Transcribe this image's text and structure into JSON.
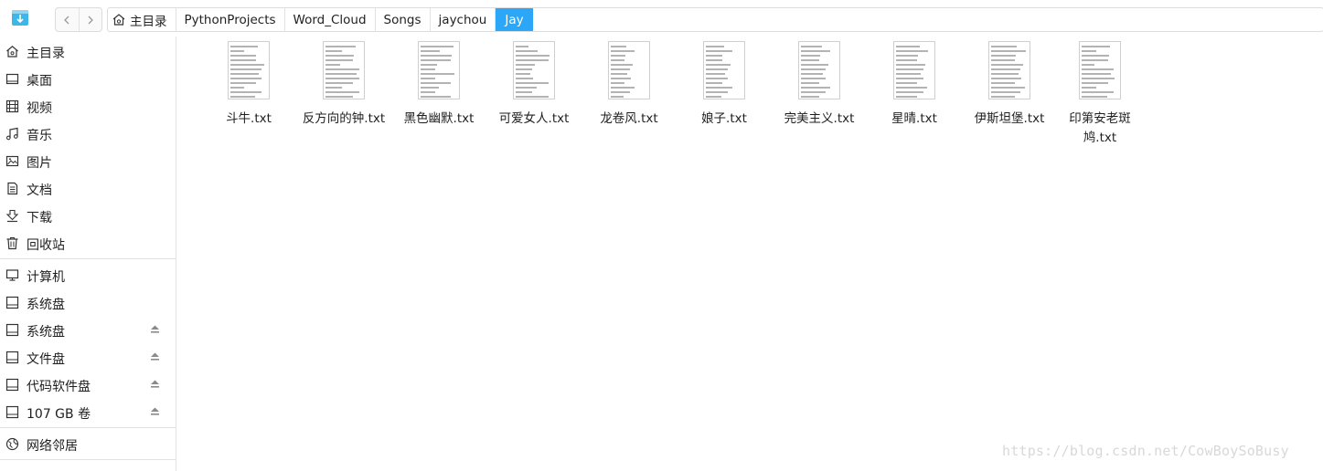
{
  "breadcrumb": {
    "home": "主目录",
    "items": [
      "PythonProjects",
      "Word_Cloud",
      "Songs",
      "jaychou"
    ],
    "current": "Jay"
  },
  "sidebar": {
    "items": [
      {
        "label": "主目录",
        "icon": "home-icon"
      },
      {
        "label": "桌面",
        "icon": "desktop-icon"
      },
      {
        "label": "视频",
        "icon": "video-icon"
      },
      {
        "label": "音乐",
        "icon": "music-icon"
      },
      {
        "label": "图片",
        "icon": "picture-icon"
      },
      {
        "label": "文档",
        "icon": "document-icon"
      },
      {
        "label": "下载",
        "icon": "download-icon"
      },
      {
        "label": "回收站",
        "icon": "trash-icon"
      }
    ],
    "devices": [
      {
        "label": "计算机",
        "icon": "computer-icon"
      },
      {
        "label": "系统盘",
        "icon": "disk-icon",
        "eject": false
      },
      {
        "label": "系统盘",
        "icon": "disk-icon",
        "eject": true
      },
      {
        "label": "文件盘",
        "icon": "disk-icon",
        "eject": true
      },
      {
        "label": "代码软件盘",
        "icon": "disk-icon",
        "eject": true
      },
      {
        "label": "107 GB 卷",
        "icon": "disk-icon",
        "eject": true
      }
    ],
    "network": {
      "label": "网络邻居",
      "icon": "network-icon"
    }
  },
  "files": [
    "斗牛.txt",
    "反方向的钟.txt",
    "黑色幽默.txt",
    "可爱女人.txt",
    "龙卷风.txt",
    "娘子.txt",
    "完美主义.txt",
    "星晴.txt",
    "伊斯坦堡.txt",
    "印第安老斑鸠.txt"
  ],
  "watermark": "https://blog.csdn.net/CowBoySoBusy",
  "colors": {
    "accent": "#2ca7f8",
    "app_icon": "#3fb6e8"
  }
}
